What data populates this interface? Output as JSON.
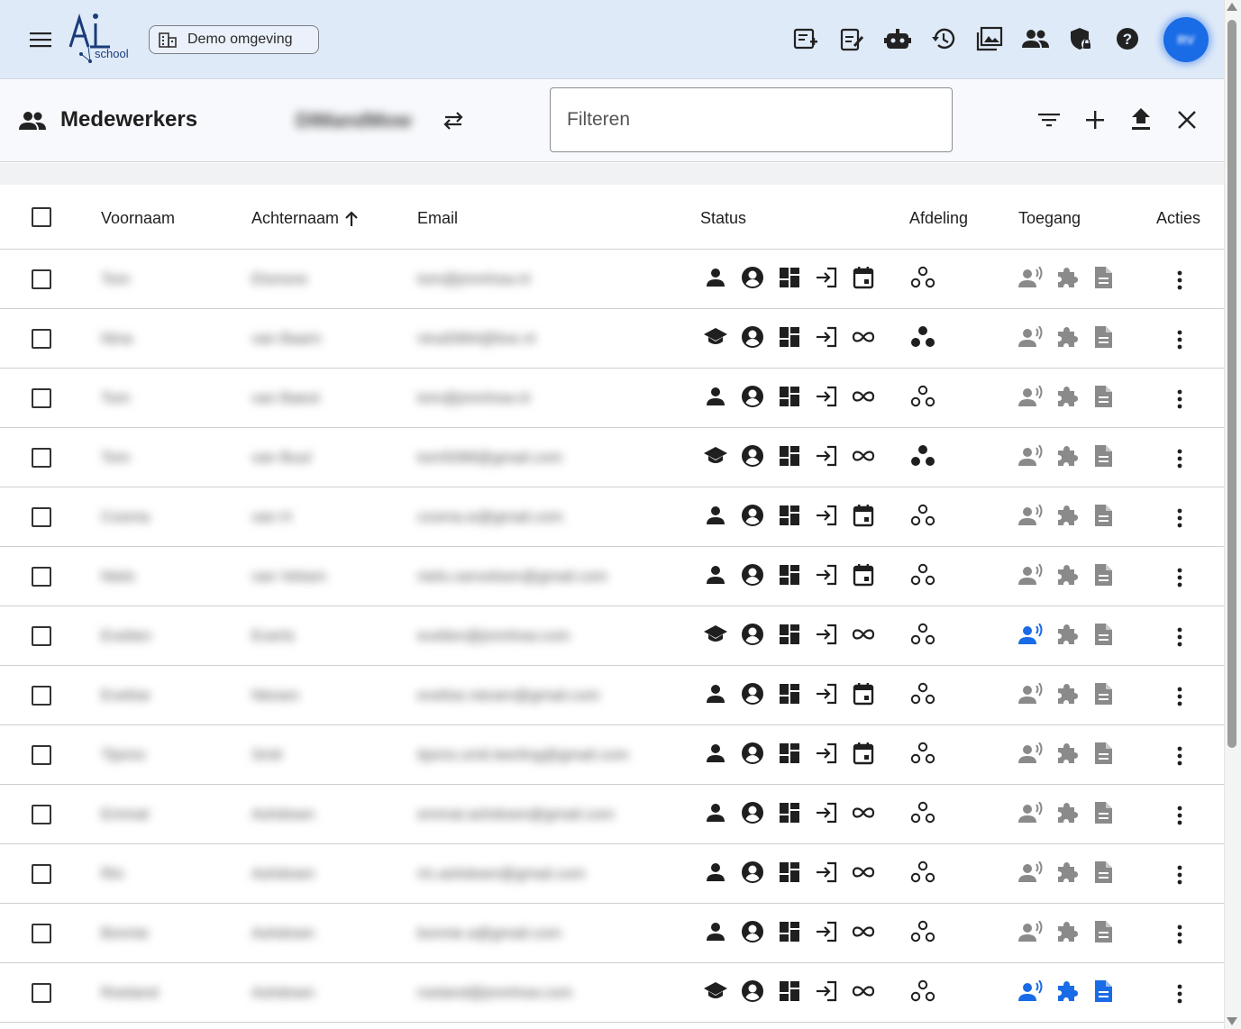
{
  "topbar": {
    "logo_text": "school",
    "environment": "Demo omgeving",
    "avatar_initials": "RV",
    "icons": [
      "playlist-add-icon",
      "assignment-edit-icon",
      "robot-icon",
      "history-icon",
      "photo-library-icon",
      "group-icon",
      "shield-lock-icon",
      "help-icon"
    ]
  },
  "header": {
    "title": "Medewerkers",
    "organization": "DIMandMow",
    "filter_placeholder": "Filteren",
    "actions": [
      "filter-list-icon",
      "add-icon",
      "upload-icon",
      "close-icon"
    ]
  },
  "table": {
    "columns": {
      "firstname": "Voornaam",
      "lastname": "Achternaam",
      "email": "Email",
      "status": "Status",
      "department": "Afdeling",
      "access": "Toegang",
      "actions": "Acties"
    },
    "sort": {
      "column": "lastname",
      "direction": "asc"
    },
    "rows": [
      {
        "first": "Tom",
        "last": "Elsmore",
        "email": "tom@jmmhsw.nl",
        "role": "person",
        "term": "calendar",
        "dept_filled": false,
        "access_active": [
          false,
          false,
          false
        ]
      },
      {
        "first": "Nina",
        "last": "van Baarn",
        "email": "nina5994@live.nl",
        "role": "school",
        "term": "infinite",
        "dept_filled": true,
        "access_active": [
          false,
          false,
          false
        ]
      },
      {
        "first": "Tom",
        "last": "van Baest",
        "email": "tom@jmmhsw.nl",
        "role": "person",
        "term": "infinite",
        "dept_filled": false,
        "access_active": [
          false,
          false,
          false
        ]
      },
      {
        "first": "Tom",
        "last": "van Buul",
        "email": "tom5088@gmail.com",
        "role": "school",
        "term": "infinite",
        "dept_filled": true,
        "access_active": [
          false,
          false,
          false
        ]
      },
      {
        "first": "Cosma",
        "last": "van H",
        "email": "cosma.w@gmail.com",
        "role": "person",
        "term": "calendar",
        "dept_filled": false,
        "access_active": [
          false,
          false,
          false
        ]
      },
      {
        "first": "Niels",
        "last": "van Velsen",
        "email": "niels.vanvelsen@gmail.com",
        "role": "person",
        "term": "calendar",
        "dept_filled": false,
        "access_active": [
          false,
          false,
          false
        ]
      },
      {
        "first": "Evelien",
        "last": "Everts",
        "email": "evelien@jmmhsw.com",
        "role": "school",
        "term": "infinite",
        "dept_filled": false,
        "access_active": [
          true,
          false,
          false
        ]
      },
      {
        "first": "Evelise",
        "last": "Niesen",
        "email": "evelise.niesen@gmail.com",
        "role": "person",
        "term": "calendar",
        "dept_filled": false,
        "access_active": [
          false,
          false,
          false
        ]
      },
      {
        "first": "Tijsmo",
        "last": "Smit",
        "email": "tijsmo.smit.leerling@gmail.com",
        "role": "person",
        "term": "calendar",
        "dept_filled": false,
        "access_active": [
          false,
          false,
          false
        ]
      },
      {
        "first": "Emmal",
        "last": "Ashdown",
        "email": "emmal.ashdown@gmail.com",
        "role": "person",
        "term": "infinite",
        "dept_filled": false,
        "access_active": [
          false,
          false,
          false
        ]
      },
      {
        "first": "Rin",
        "last": "Ashdown",
        "email": "rin.ashdown@gmail.com",
        "role": "person",
        "term": "infinite",
        "dept_filled": false,
        "access_active": [
          false,
          false,
          false
        ]
      },
      {
        "first": "Bonnie",
        "last": "Ashdown",
        "email": "bonnie.a@gmail.com",
        "role": "person",
        "term": "infinite",
        "dept_filled": false,
        "access_active": [
          false,
          false,
          false
        ]
      },
      {
        "first": "Roeland",
        "last": "Ashdown",
        "email": "roeland@jmmhsw.com",
        "role": "school",
        "term": "infinite",
        "dept_filled": false,
        "access_active": [
          true,
          true,
          true
        ]
      }
    ]
  },
  "colors": {
    "topbar_bg": "#dfeaf8",
    "accent": "#1a6be6",
    "icon_dark": "#1f1f1f",
    "icon_muted": "#8a8a8a"
  }
}
